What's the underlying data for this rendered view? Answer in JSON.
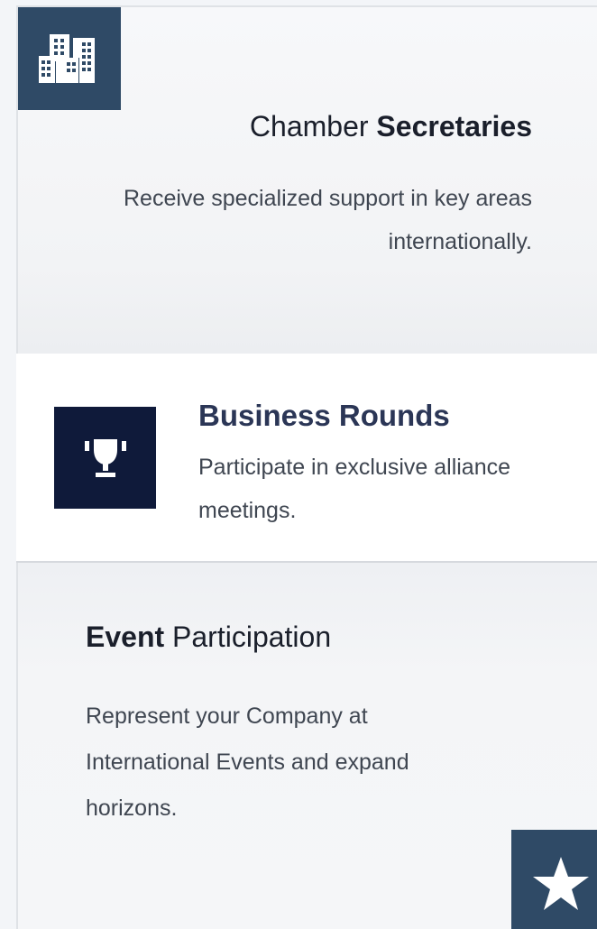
{
  "cards": [
    {
      "icon": "buildings-icon",
      "title_regular": "Chamber ",
      "title_bold": "Secretaries",
      "description": "Receive specialized support in key areas internationally.",
      "icon_bg": "#2f4a66"
    },
    {
      "icon": "trophy-icon",
      "title": "Business Rounds",
      "description": "Participate in exclusive alliance meetings.",
      "icon_bg": "#0f1a3a",
      "title_color": "#2b3656"
    },
    {
      "icon": "star-icon",
      "title_bold": "Event",
      "title_regular": " Participation",
      "description": "Represent your Company at International Events and expand horizons.",
      "icon_bg": "#2f4a66"
    }
  ]
}
